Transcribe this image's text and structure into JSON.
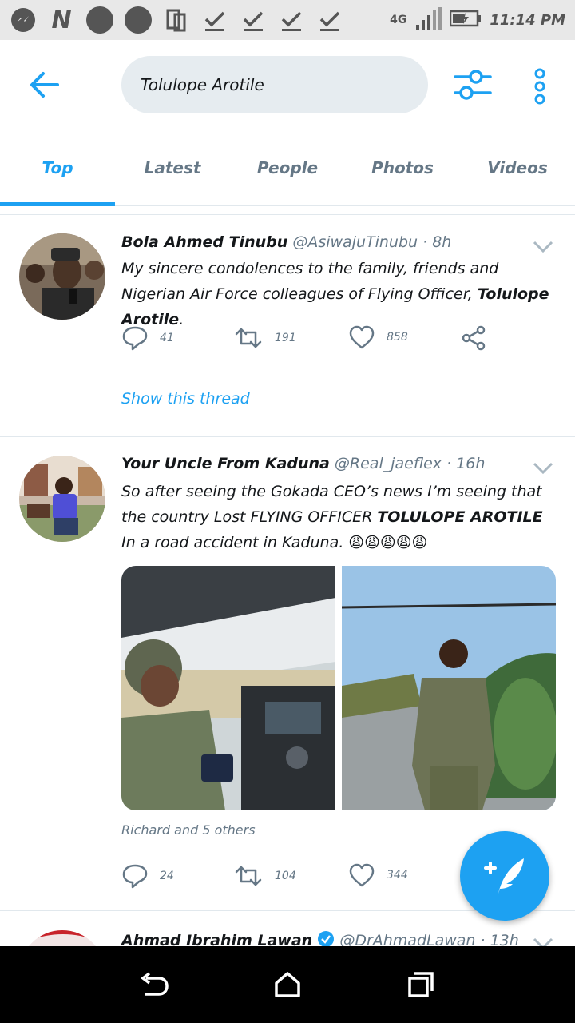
{
  "status_bar": {
    "network": "4G",
    "time": "11:14 PM"
  },
  "search": {
    "query": "Tolulope Arotile"
  },
  "tabs": [
    "Top",
    "Latest",
    "People",
    "Photos",
    "Videos"
  ],
  "tweets": [
    {
      "name": "Bola Ahmed Tinubu",
      "handle": "@AsiwajuTinubu",
      "time": "· 8h",
      "text_before": "My sincere condolences to the family, friends and Nigerian Air Force colleagues of Flying Officer, ",
      "text_bold": "Tolulope Arotile",
      "text_after": ".",
      "replies": "41",
      "retweets": "191",
      "likes": "858",
      "show_thread": "Show this thread"
    },
    {
      "name": "Your Uncle From Kaduna",
      "handle": "@Real_jaeflex",
      "time": "· 16h",
      "text_before": "So after seeing the Gokada CEO’s news I’m seeing that the country Lost FLYING OFFICER ",
      "text_bold": "TOLULOPE AROTILE",
      "text_after": " In a road accident in Kaduna. 😩😩😩😩😩",
      "liked_by": "Richard and 5 others",
      "replies": "24",
      "retweets": "104",
      "likes": "344"
    },
    {
      "name": "Ahmad Ibrahim Lawan",
      "handle": "@DrAhmadLawan",
      "time": "· 13h"
    }
  ],
  "colors": {
    "accent": "#1da1f2",
    "muted": "#657786",
    "search_bg": "#e6ecf0"
  }
}
